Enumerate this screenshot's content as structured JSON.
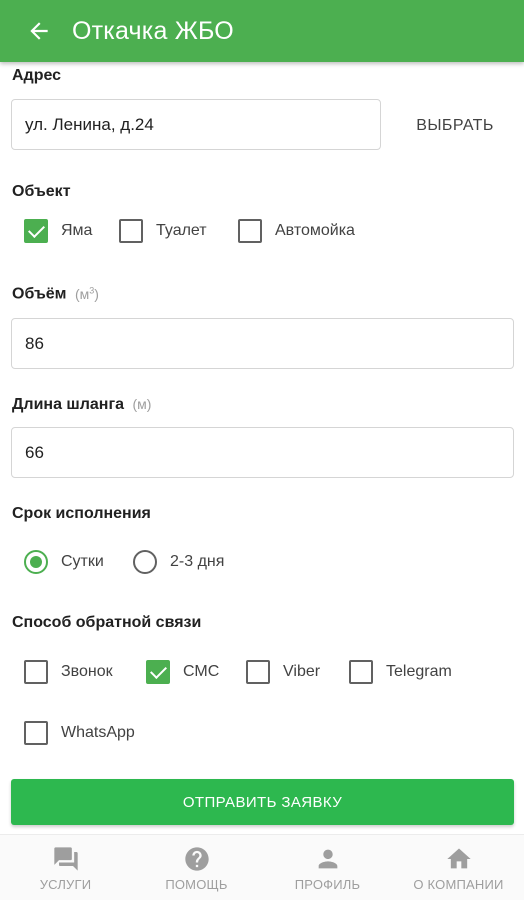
{
  "header": {
    "title": "Откачка ЖБО",
    "back_icon": "arrow-back-icon"
  },
  "address": {
    "label": "Адрес",
    "value": "ул. Ленина, д.24",
    "pick_button": "ВЫБРАТЬ"
  },
  "object": {
    "label": "Объект",
    "options": [
      {
        "label": "Яма",
        "checked": true
      },
      {
        "label": "Туалет",
        "checked": false
      },
      {
        "label": "Автомойка",
        "checked": false
      }
    ]
  },
  "volume": {
    "label": "Объём",
    "unit": "м",
    "unit_power": "3",
    "value": "86"
  },
  "hose": {
    "label": "Длина шланга",
    "unit": "м",
    "value": "66"
  },
  "deadline": {
    "label": "Срок исполнения",
    "options": [
      {
        "label": "Сутки",
        "selected": true
      },
      {
        "label": "2-3 дня",
        "selected": false
      }
    ]
  },
  "feedback": {
    "label": "Способ обратной связи",
    "options": [
      {
        "label": "Звонок",
        "checked": false
      },
      {
        "label": "СМС",
        "checked": true
      },
      {
        "label": "Viber",
        "checked": false
      },
      {
        "label": "Telegram",
        "checked": false
      },
      {
        "label": "WhatsApp",
        "checked": false
      }
    ]
  },
  "submit": {
    "label": "ОТПРАВИТЬ ЗАЯВКУ"
  },
  "bottom_nav": [
    {
      "label": "УСЛУГИ",
      "icon": "chat-bubbles-icon"
    },
    {
      "label": "ПОМОЩЬ",
      "icon": "help-circle-icon"
    },
    {
      "label": "ПРОФИЛЬ",
      "icon": "person-icon"
    },
    {
      "label": "О КОМПАНИИ",
      "icon": "home-icon"
    }
  ],
  "colors": {
    "accent": "#4caf50",
    "button": "#2db84f",
    "nav_inactive": "#9e9e9e"
  }
}
